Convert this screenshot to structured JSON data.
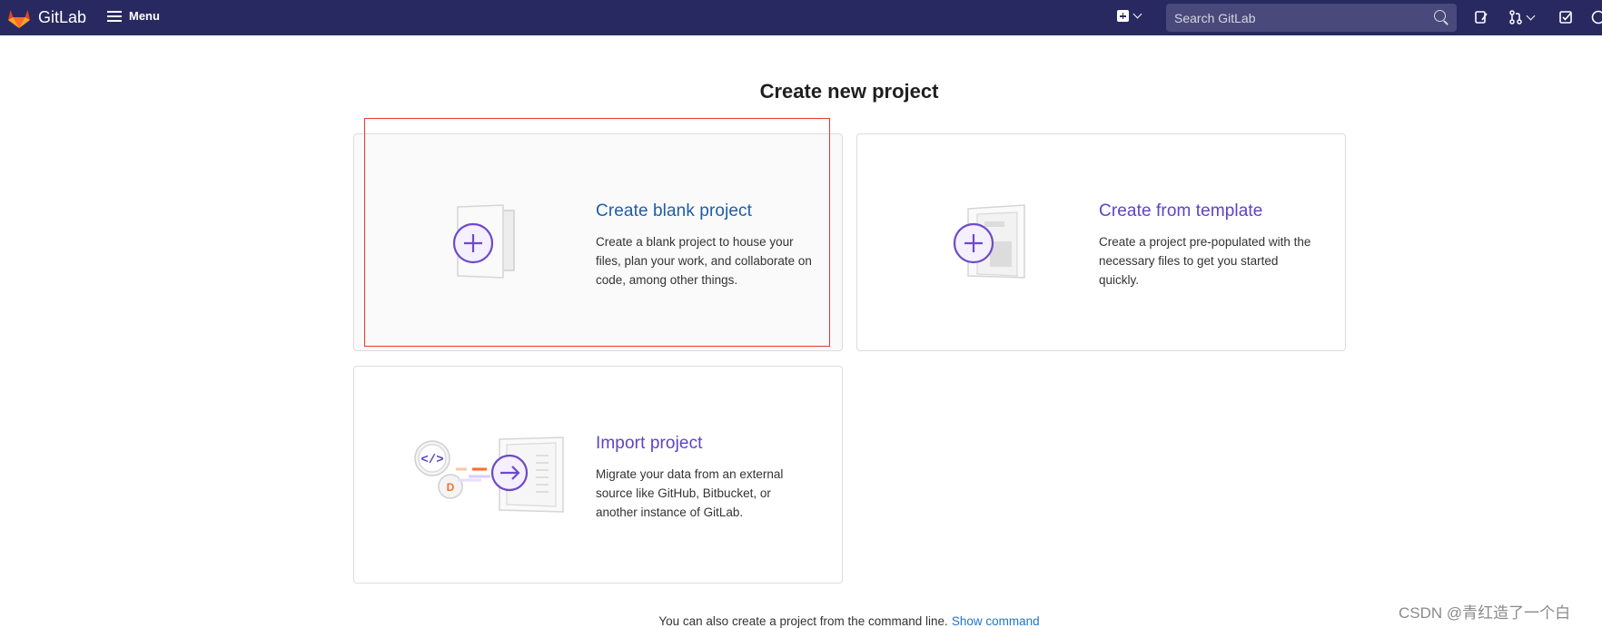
{
  "header": {
    "brand": "GitLab",
    "menu_label": "Menu",
    "search_placeholder": "Search GitLab",
    "colors": {
      "bar": "#292961",
      "search": "#49497b"
    }
  },
  "page_title": "Create new project",
  "cards": [
    {
      "title": "Create blank project",
      "description": "Create a blank project to house your files, plan your work, and collaborate on code, among other things.",
      "icon": "blank-project-illustration"
    },
    {
      "title": "Create from template",
      "description": "Create a project pre-populated with the necessary files to get you started quickly.",
      "icon": "template-project-illustration"
    },
    {
      "title": "Import project",
      "description": "Migrate your data from an external source like GitHub, Bitbucket, or another instance of GitLab.",
      "icon": "import-project-illustration"
    }
  ],
  "footer": {
    "text": "You can also create a project from the command line.",
    "link": "Show command"
  },
  "watermark": "CSDN @青红造了一个白",
  "accent": "#5c43c9",
  "highlight_color": "#e53935"
}
